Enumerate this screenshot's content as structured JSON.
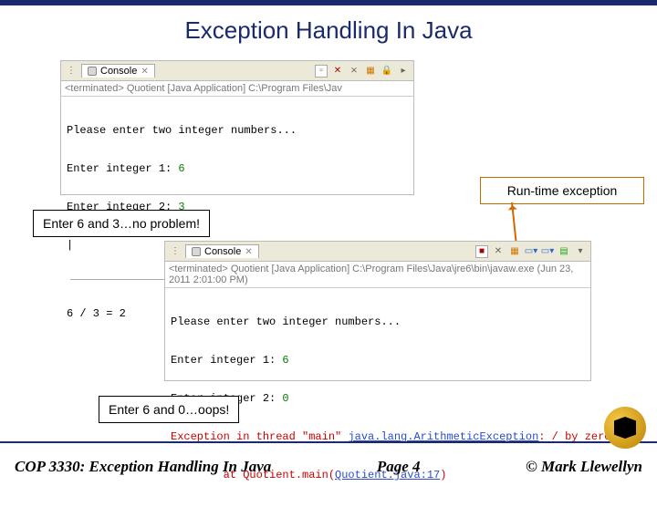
{
  "title": "Exception Handling In Java",
  "console1": {
    "tab": "Console",
    "terminated": "<terminated> Quotient [Java Application] C:\\Program Files\\Jav",
    "line1": "Please enter two integer numbers...",
    "line2a": "Enter integer 1: ",
    "line2b": "6",
    "line3a": "Enter integer 2: ",
    "line3b": "3",
    "cursor": "|",
    "result": "6 / 3 = 2"
  },
  "callout_runtime": "Run-time exception",
  "callout_6_3": "Enter 6 and 3…no problem!",
  "console2": {
    "tab": "Console",
    "terminated": "<terminated> Quotient [Java Application] C:\\Program Files\\Java\\jre6\\bin\\javaw.exe (Jun 23, 2011 2:01:00 PM)",
    "l1": "Please enter two integer numbers...",
    "l2a": "Enter integer 1: ",
    "l2b": "6",
    "l3a": "Enter integer 2: ",
    "l3b": "0",
    "e1a": "Exception in thread \"main\" ",
    "e1b": "java.lang.ArithmeticException",
    "e1c": ": / by zero",
    "e2a": "        at Quotient.main(",
    "e2b": "Quotient.java:17",
    "e2c": ")"
  },
  "callout_6_0": "Enter 6 and 0…oops!",
  "footer": {
    "left": "COP 3330:  Exception Handling In Java",
    "center": "Page 4",
    "right": "© Mark Llewellyn"
  }
}
